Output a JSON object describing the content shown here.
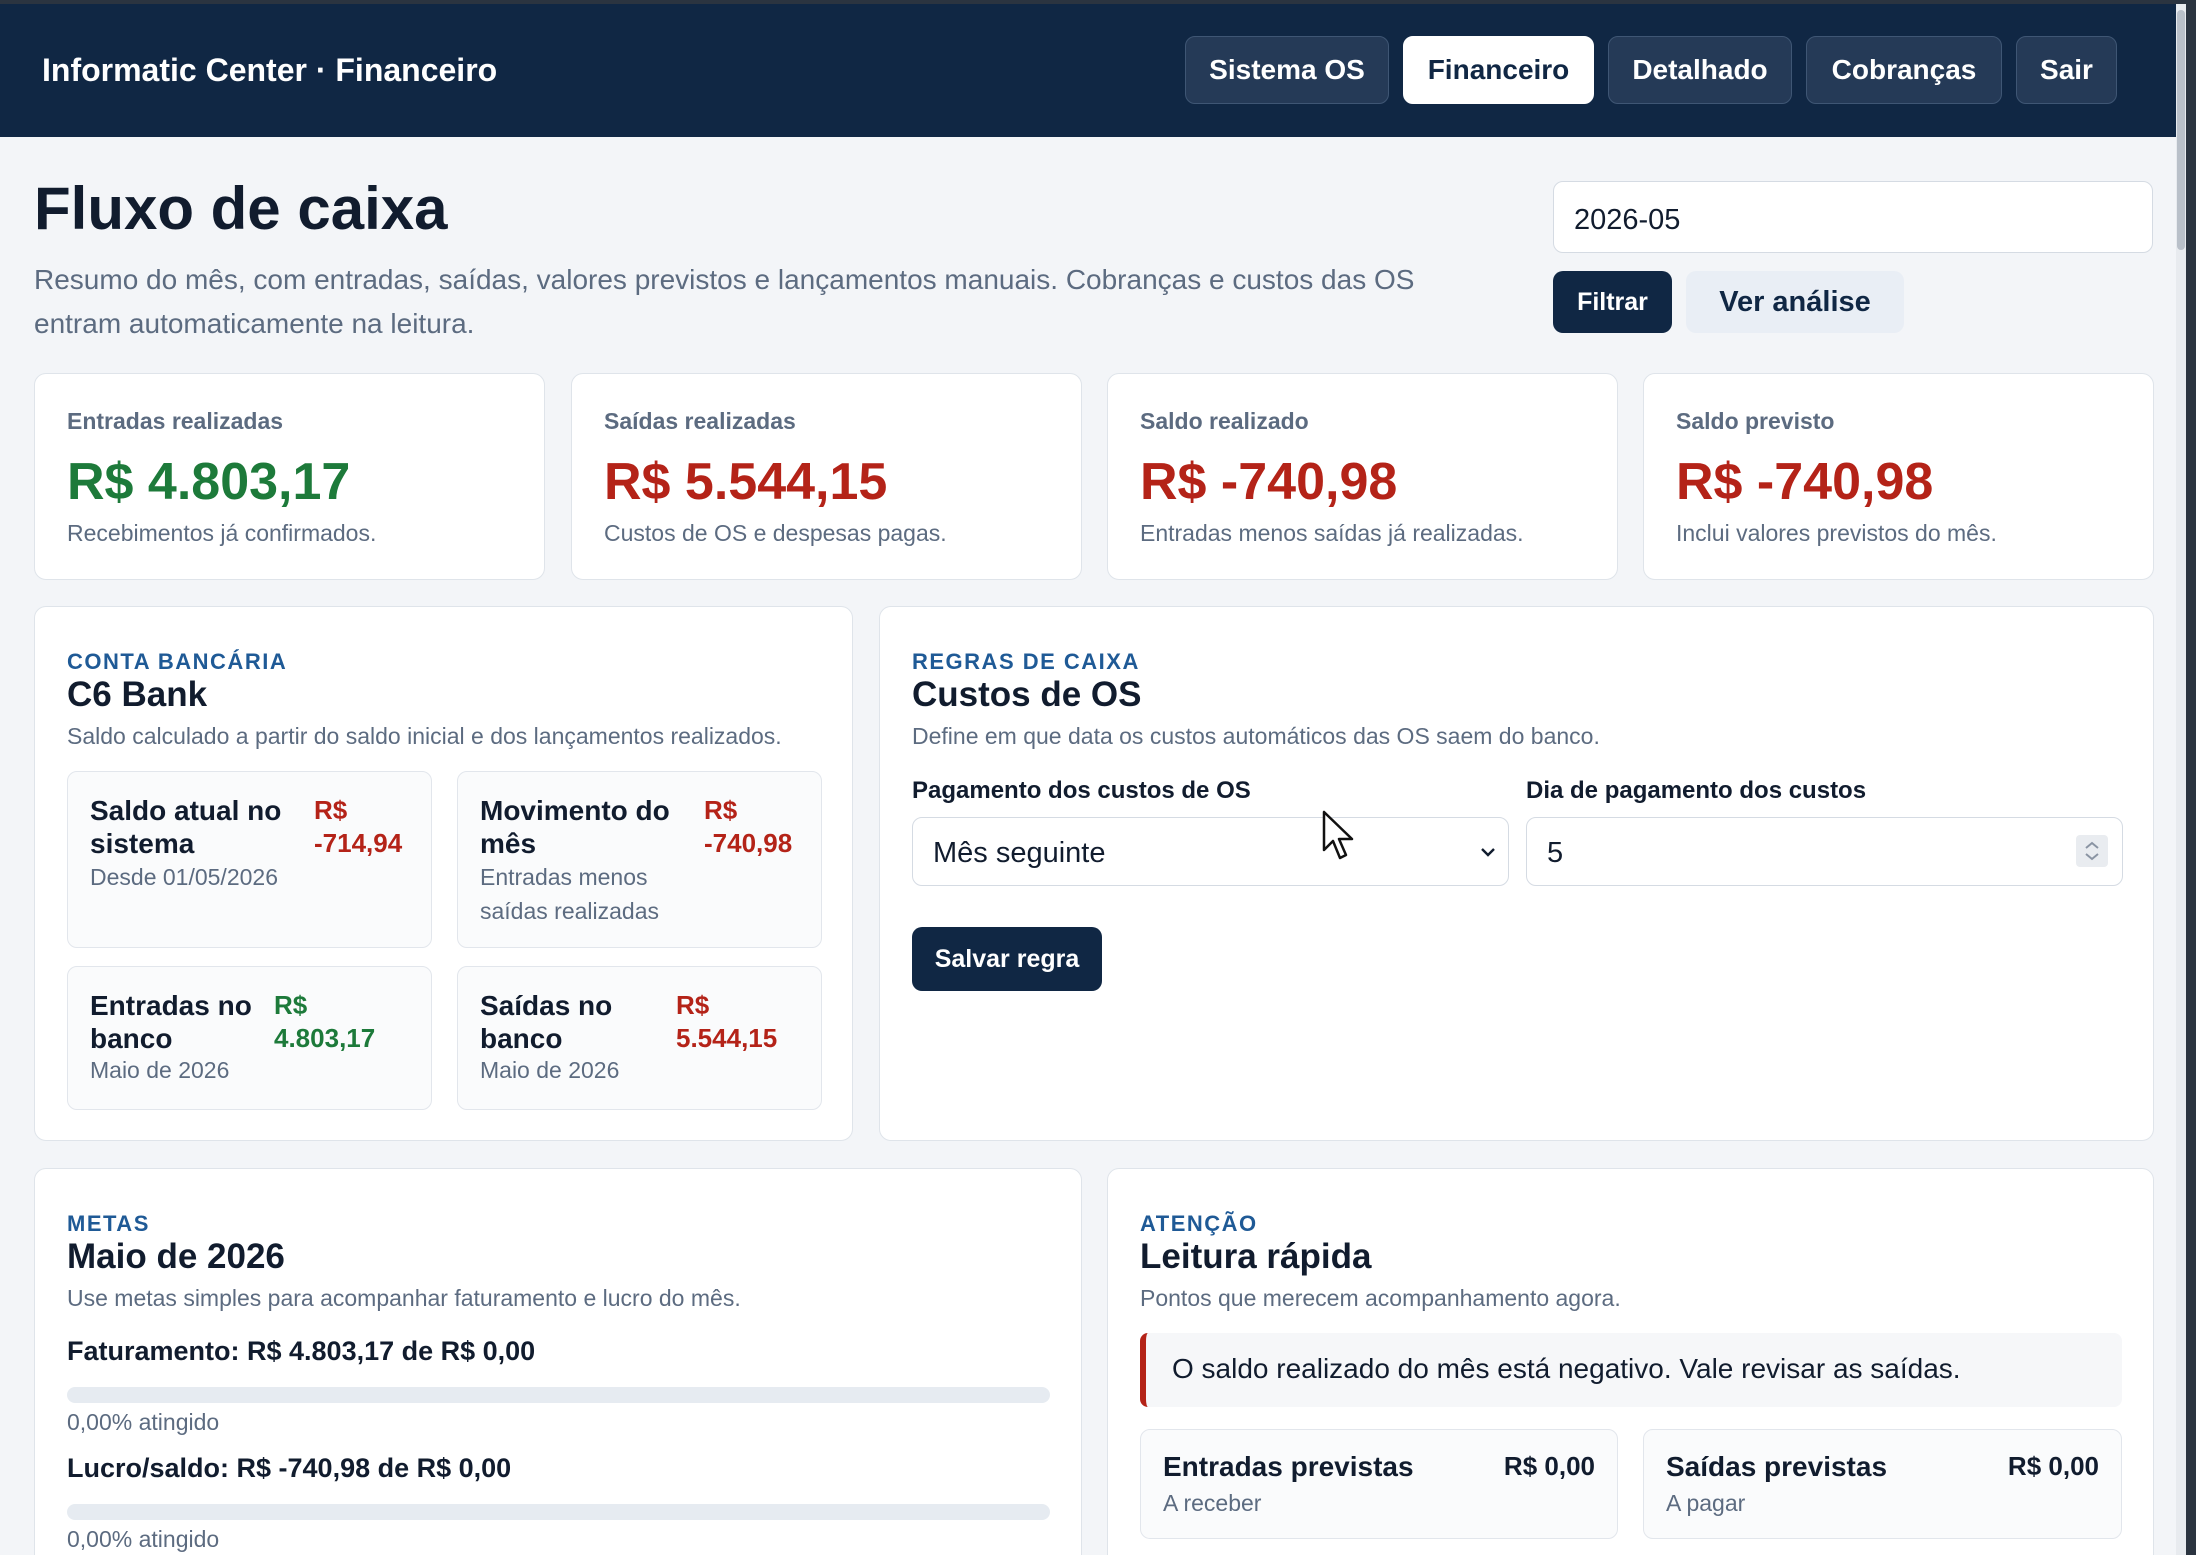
{
  "app": {
    "brand": "Informatic Center · Financeiro"
  },
  "nav": [
    {
      "label": "Sistema OS",
      "active": false
    },
    {
      "label": "Financeiro",
      "active": true
    },
    {
      "label": "Detalhado",
      "active": false
    },
    {
      "label": "Cobranças",
      "active": false
    },
    {
      "label": "Sair",
      "active": false
    }
  ],
  "header": {
    "title": "Fluxo de caixa",
    "subtitle": "Resumo do mês, com entradas, saídas, valores previstos e lançamentos manuais. Cobranças e custos das OS entram automaticamente na leitura.",
    "month_value": "2026-05",
    "filter_label": "Filtrar",
    "analysis_label": "Ver análise"
  },
  "kpis": [
    {
      "label": "Entradas realizadas",
      "value": "R$ 4.803,17",
      "note": "Recebimentos já confirmados.",
      "tone": "green"
    },
    {
      "label": "Saídas realizadas",
      "value": "R$ 5.544,15",
      "note": "Custos de OS e despesas pagas.",
      "tone": "red"
    },
    {
      "label": "Saldo realizado",
      "value": "R$ -740,98",
      "note": "Entradas menos saídas já realizadas.",
      "tone": "red"
    },
    {
      "label": "Saldo previsto",
      "value": "R$ -740,98",
      "note": "Inclui valores previstos do mês.",
      "tone": "red"
    }
  ],
  "bank": {
    "tag": "CONTA BANCÁRIA",
    "title": "C6 Bank",
    "desc": "Saldo calculado a partir do saldo inicial e dos lançamentos realizados.",
    "items": [
      {
        "label": "Saldo atual no sistema",
        "value": "R$ -714,94",
        "note": "Desde 01/05/2026",
        "tone": "red"
      },
      {
        "label": "Movimento do mês",
        "value": "R$ -740,98",
        "note": "Entradas menos saídas realizadas",
        "tone": "red"
      },
      {
        "label": "Entradas no banco",
        "value": "R$ 4.803,17",
        "note": "Maio de 2026",
        "tone": "green"
      },
      {
        "label": "Saídas no banco",
        "value": "R$ 5.544,15",
        "note": "Maio de 2026",
        "tone": "red"
      }
    ]
  },
  "rules": {
    "tag": "REGRAS DE CAIXA",
    "title": "Custos de OS",
    "desc": "Define em que data os custos automáticos das OS saem do banco.",
    "payment_label": "Pagamento dos custos de OS",
    "payment_value": "Mês seguinte",
    "day_label": "Dia de pagamento dos custos",
    "day_value": "5",
    "save_label": "Salvar regra"
  },
  "goals": {
    "tag": "METAS",
    "title": "Maio de 2026",
    "desc": "Use metas simples para acompanhar faturamento e lucro do mês.",
    "items": [
      {
        "text": "Faturamento: R$ 4.803,17 de R$ 0,00",
        "pct_text": "0,00% atingido",
        "fraction": 0
      },
      {
        "text": "Lucro/saldo: R$ -740,98 de R$ 0,00",
        "pct_text": "0,00% atingido",
        "fraction": 0
      }
    ]
  },
  "attention": {
    "tag": "ATENÇÃO",
    "title": "Leitura rápida",
    "desc": "Pontos que merecem acompanhamento agora.",
    "alert": "O saldo realizado do mês está negativo. Vale revisar as saídas.",
    "items": [
      {
        "label": "Entradas previstas",
        "value": "R$ 0,00",
        "note": "A receber"
      },
      {
        "label": "Saídas previstas",
        "value": "R$ 0,00",
        "note": "A pagar"
      }
    ]
  },
  "colors": {
    "navy": "#102744",
    "green": "#1d7a3a",
    "red": "#b42318",
    "tag_blue": "#1f5a96"
  }
}
